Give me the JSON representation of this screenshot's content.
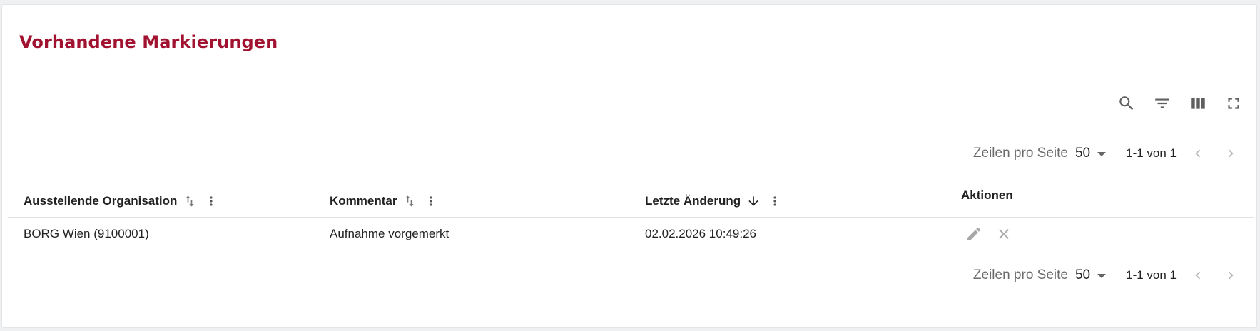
{
  "title": "Vorhandene Markierungen",
  "toolbar": {
    "icons": [
      "search-icon",
      "filter-icon",
      "view-column-icon",
      "fullscreen-icon"
    ]
  },
  "pagination": {
    "rows_label": "Zeilen pro Seite",
    "rows_per_page": "50",
    "range": "1-1 von 1"
  },
  "table": {
    "columns": [
      {
        "label": "Ausstellende Organisation",
        "sort": "unsorted"
      },
      {
        "label": "Kommentar",
        "sort": "unsorted"
      },
      {
        "label": "Letzte Änderung",
        "sort": "descending"
      },
      {
        "label": "Aktionen"
      }
    ],
    "rows": [
      {
        "organisation": "BORG Wien (9100001)",
        "kommentar": "Aufnahme vorgemerkt",
        "letzte_aenderung": "02.02.2026 10:49:26"
      }
    ],
    "row_actions": [
      "edit-icon",
      "close-icon"
    ]
  },
  "colors": {
    "title": "#a0122f",
    "icon_disabled": "#a8a8a8"
  }
}
